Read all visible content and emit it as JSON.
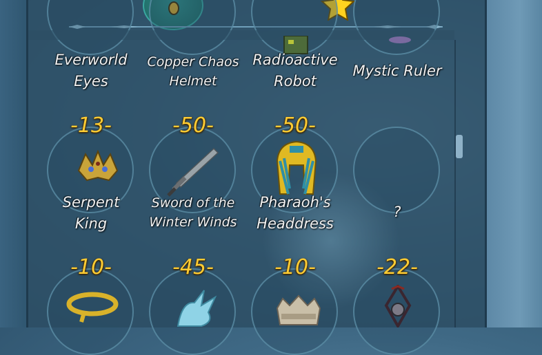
{
  "rows": {
    "top": [
      {
        "name_line1": "Everworld",
        "name_line2": "Eyes"
      },
      {
        "name_line1": "Copper Chaos",
        "name_line2": "Helmet"
      },
      {
        "name_line1": "Radioactive",
        "name_line2": "Robot"
      },
      {
        "name_line1": "Mystic Ruler",
        "name_line2": ""
      }
    ],
    "middle": [
      {
        "cost": "-13-",
        "name_line1": "Serpent",
        "name_line2": "King",
        "icon": "serpent-crown-icon"
      },
      {
        "cost": "-50-",
        "name_line1": "Sword of the",
        "name_line2": "Winter Winds",
        "icon": "sword-icon"
      },
      {
        "cost": "-50-",
        "name_line1": "Pharaoh's",
        "name_line2": "Headdress",
        "icon": "pharaoh-headdress-icon"
      },
      {
        "cost": "",
        "name_line1": "?",
        "name_line2": "",
        "icon": ""
      }
    ],
    "bottom": [
      {
        "cost": "-10-",
        "icon": "gold-chain-icon"
      },
      {
        "cost": "-45-",
        "icon": "ice-dragon-icon"
      },
      {
        "cost": "-10-",
        "icon": "silver-crown-icon"
      },
      {
        "cost": "-22-",
        "icon": "dark-amulet-icon"
      }
    ]
  },
  "colors": {
    "cost": "#ffcc33",
    "name": "#f2f2f2",
    "panel": "#2d4e64",
    "slot_border": "#5f91aa"
  }
}
